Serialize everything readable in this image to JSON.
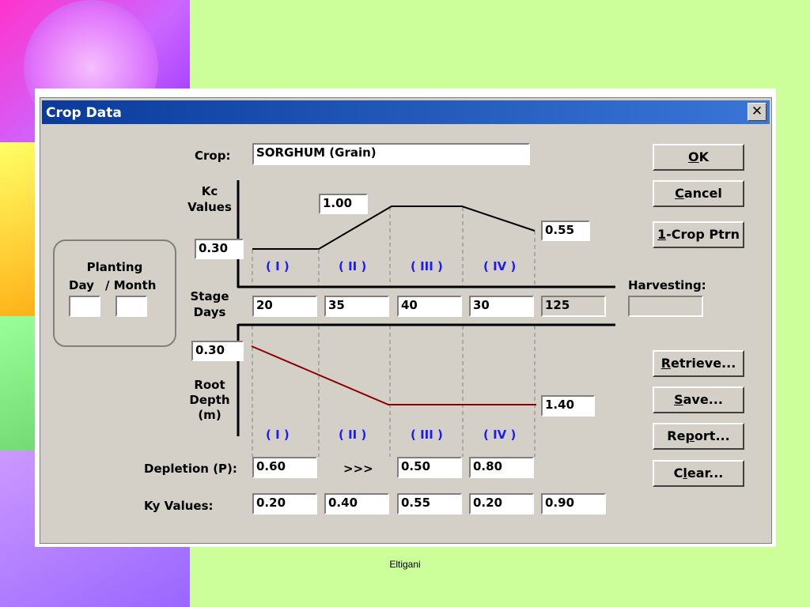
{
  "window": {
    "title": "Crop Data",
    "close_label": "✕"
  },
  "crop": {
    "label": "Crop:",
    "value": "SORGHUM (Grain)"
  },
  "kc": {
    "label_line1": "Kc",
    "label_line2": "Values",
    "initial": "0.30",
    "mid": "1.00",
    "end": "0.55"
  },
  "stages": [
    "( I )",
    "( II )",
    "( III )",
    "( IV )"
  ],
  "planting": {
    "title": "Planting",
    "day_label": "Day",
    "month_label": "/ Month",
    "day_value": "",
    "month_value": ""
  },
  "stage_days": {
    "label_line1": "Stage",
    "label_line2": "Days",
    "values": [
      "20",
      "35",
      "40",
      "30"
    ],
    "total": "125"
  },
  "harvesting": {
    "label": "Harvesting:",
    "value": ""
  },
  "root": {
    "label_line1": "Root",
    "label_line2": "Depth",
    "label_line3": "(m)",
    "initial": "0.30",
    "max": "1.40"
  },
  "depletion": {
    "label": "Depletion (P):",
    "values": [
      "0.60",
      "0.50",
      "0.80"
    ],
    "arrow": ">>>"
  },
  "ky": {
    "label": "Ky Values:",
    "values": [
      "0.20",
      "0.40",
      "0.55",
      "0.20",
      "0.90"
    ]
  },
  "buttons": {
    "ok": {
      "u": "O",
      "rest": "K"
    },
    "cancel": {
      "u": "C",
      "rest": "ancel"
    },
    "crop_ptrn": {
      "u": "1",
      "rest": "-Crop Ptrn"
    },
    "retrieve": {
      "u": "R",
      "rest": "etrieve..."
    },
    "save": {
      "u": "S",
      "rest": "ave..."
    },
    "report": {
      "pre": "Re",
      "u": "p",
      "rest": "ort..."
    },
    "clear": {
      "pre": "C",
      "u": "l",
      "rest": "ear..."
    }
  },
  "footer": {
    "text": "Eltigani"
  },
  "colors": {
    "title_bar": "#0a3b9b",
    "stage_label": "#1a1aff",
    "root_line": "#8b0000",
    "background": "#ccff99"
  }
}
